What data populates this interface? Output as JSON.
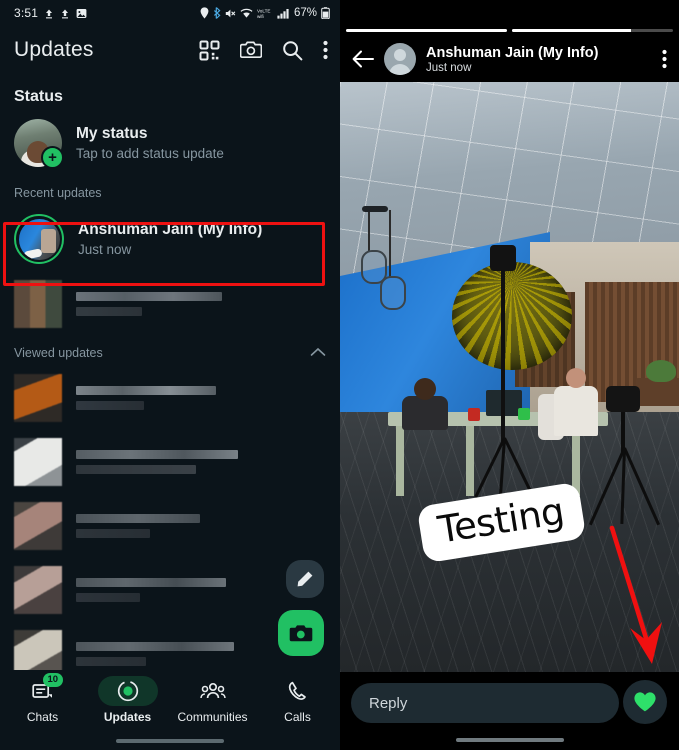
{
  "left": {
    "statusbar": {
      "time": "3:51",
      "left_icons": [
        "upload-icon",
        "upload-icon",
        "image-icon"
      ],
      "right_icons": [
        "location-icon",
        "bluetooth-icon",
        "mute-icon",
        "wifi-icon",
        "volte-icon",
        "signal-icon"
      ],
      "battery": "67%"
    },
    "appbar": {
      "title": "Updates",
      "actions": [
        "qr-scan-icon",
        "camera-icon",
        "search-icon",
        "overflow-menu-icon"
      ]
    },
    "status_section": {
      "title": "Status",
      "my_status": {
        "name": "My status",
        "subtitle": "Tap to add status update"
      },
      "recent_label": "Recent updates",
      "recent_items": [
        {
          "name": "Anshuman Jain (My Info)",
          "time": "Just now",
          "highlighted": true
        }
      ],
      "viewed_label": "Viewed updates",
      "viewed_collapse_icon": "chevron-up-icon",
      "redacted_recent_count": 1,
      "redacted_viewed_count": 4
    },
    "fabs": [
      {
        "name": "compose-status-fab",
        "icon": "pencil-icon",
        "color": "#2a3942"
      },
      {
        "name": "camera-status-fab",
        "icon": "camera-icon",
        "color": "#21c063"
      }
    ],
    "bottom_nav": [
      {
        "label": "Chats",
        "icon": "chats-icon",
        "badge": "10",
        "active": false
      },
      {
        "label": "Updates",
        "icon": "updates-icon",
        "badge": "",
        "active": true
      },
      {
        "label": "Communities",
        "icon": "communities-icon",
        "badge": "",
        "active": false
      },
      {
        "label": "Calls",
        "icon": "calls-icon",
        "badge": "",
        "active": false
      }
    ]
  },
  "right": {
    "progress_segments": [
      100,
      74
    ],
    "header": {
      "back_icon": "back-arrow-icon",
      "name": "Anshuman Jain (My Info)",
      "time": "Just now",
      "overflow_icon": "overflow-menu-icon"
    },
    "story": {
      "sticker_text": "Testing",
      "description": "photo-studio-scene"
    },
    "reply": {
      "placeholder": "Reply",
      "like_icon": "heart-icon"
    }
  },
  "annotations": {
    "highlight_box_color": "#ee1111",
    "arrow_color": "#f01010",
    "arrow_target": "heart-like-button"
  }
}
